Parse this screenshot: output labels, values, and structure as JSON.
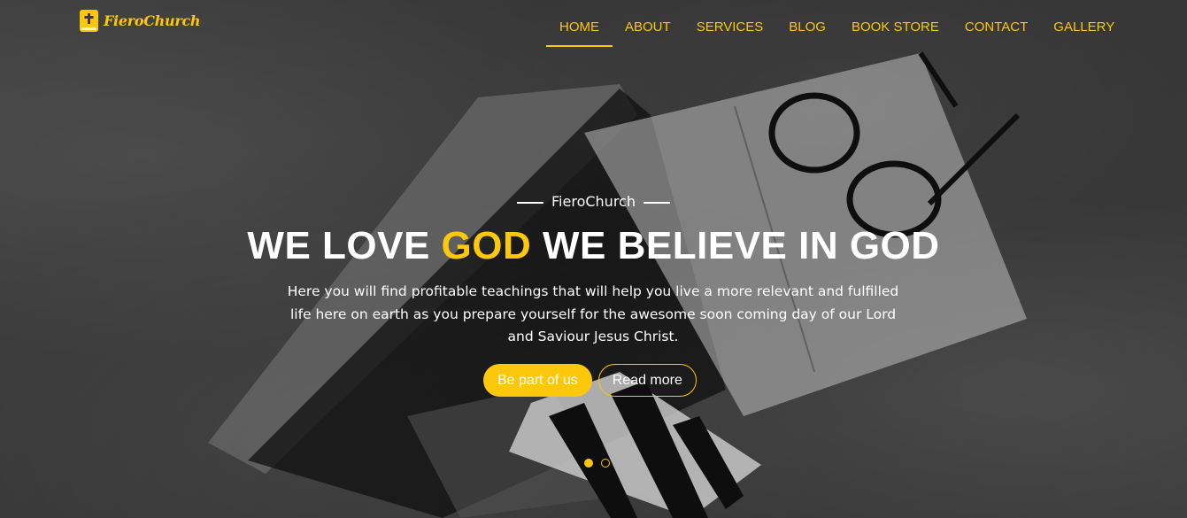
{
  "brand": {
    "name": "FieroChurch",
    "accent": "#fdc70c"
  },
  "nav": {
    "items": [
      {
        "label": "HOME",
        "active": true
      },
      {
        "label": "ABOUT"
      },
      {
        "label": "SERVICES"
      },
      {
        "label": "BLOG"
      },
      {
        "label": "BOOK STORE"
      },
      {
        "label": "CONTACT"
      },
      {
        "label": "GALLERY"
      }
    ]
  },
  "hero": {
    "eyebrow": "FieroChurch",
    "headline_pre": "WE LOVE ",
    "headline_highlight": "GOD",
    "headline_post": " WE BELIEVE IN GOD",
    "subtext": "Here you will find profitable teachings that will help you live a more relevant and fulfilled life here on earth as you prepare yourself for the awesome soon coming day of our Lord and Saviour Jesus Christ.",
    "primary_button": "Be part of us",
    "secondary_button": "Read more",
    "slides": {
      "count": 2,
      "active": 1
    }
  }
}
